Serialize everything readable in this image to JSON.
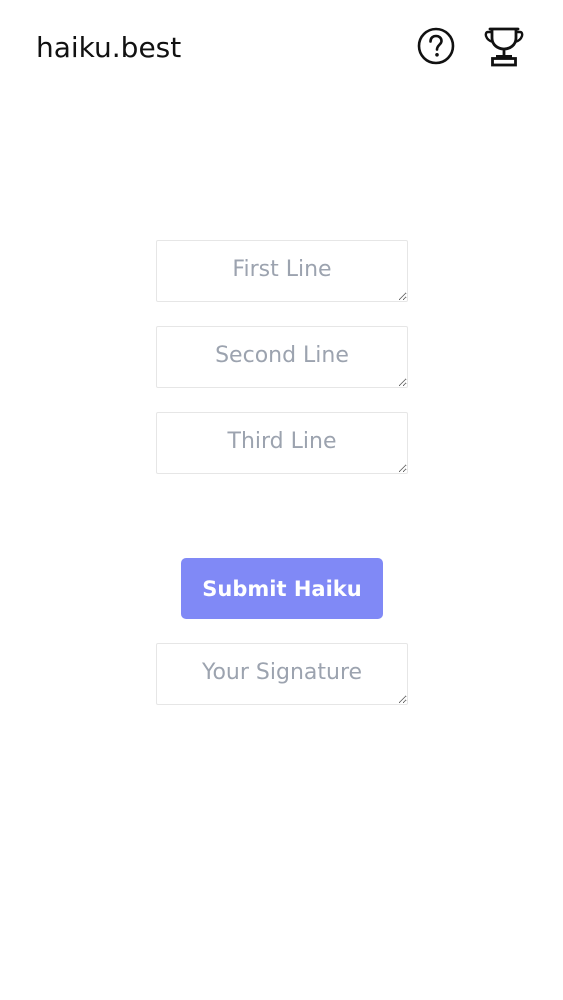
{
  "header": {
    "brand": "haiku.best",
    "help_icon": "question-circle-icon",
    "trophy_icon": "trophy-icon"
  },
  "form": {
    "line1": {
      "placeholder": "First Line",
      "value": ""
    },
    "line2": {
      "placeholder": "Second Line",
      "value": ""
    },
    "line3": {
      "placeholder": "Third Line",
      "value": ""
    },
    "submit_label": "Submit Haiku",
    "signature": {
      "placeholder": "Your Signature",
      "value": ""
    }
  },
  "colors": {
    "accent": "#8089f6",
    "placeholder": "#9ca3af",
    "border": "#e6e6e6",
    "text": "#111111"
  }
}
